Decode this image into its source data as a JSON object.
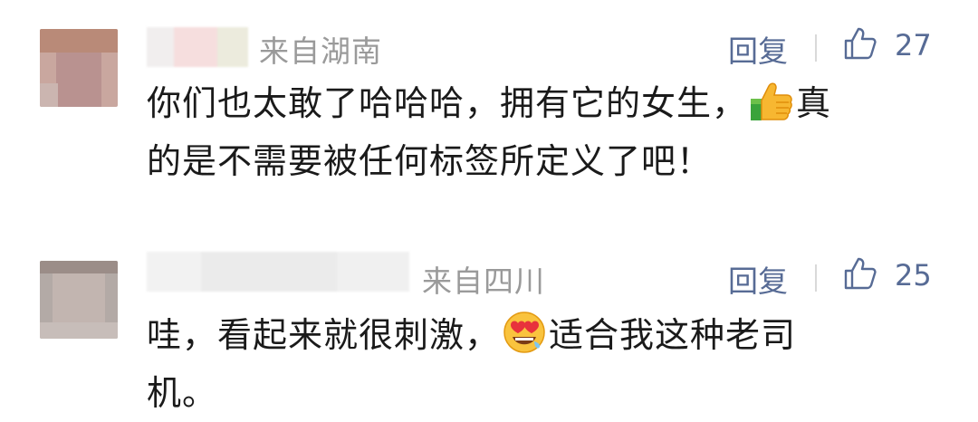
{
  "comments": [
    {
      "location": "来自湖南",
      "reply_label": "回复",
      "likes": "27",
      "text_line1_before": "你们也太敢了哈哈哈，拥有它的女生，",
      "text_line1_emoji": "thumbs-up-emoji",
      "text_line1_after": "真",
      "text_line2": "的是不需要被任何标签所定义了吧！"
    },
    {
      "location": "来自四川",
      "reply_label": "回复",
      "likes": "25",
      "text_line1_before": "哇，看起来就很刺激，",
      "text_line1_emoji": "heart-eyes-emoji",
      "text_line1_after": "适合我这种老司",
      "text_line2": "机。"
    }
  ],
  "colors": {
    "link_blue": "#576b95",
    "meta_gray": "#9a9a9a",
    "text_dark": "#1a1a1a"
  }
}
